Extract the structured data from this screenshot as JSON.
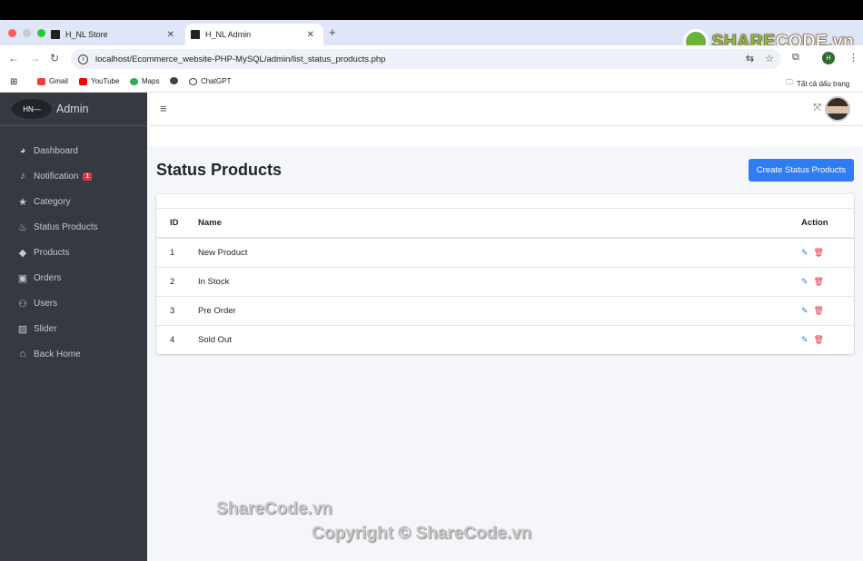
{
  "browser": {
    "tabs": [
      {
        "label": "H_NL Store",
        "active": false
      },
      {
        "label": "H_NL Admin",
        "active": true
      }
    ],
    "url": "localhost/Ecommerce_website-PHP-MySQL/admin/list_status_products.php",
    "profile_initial": "H",
    "bookmarks": [
      {
        "label": "Gmail",
        "color": "#ea4335"
      },
      {
        "label": "YouTube",
        "color": "#ff0000"
      },
      {
        "label": "Maps",
        "color": "#34a853"
      },
      {
        "label": "",
        "color": "#444444"
      },
      {
        "label": "ChatGPT",
        "color": "#444444"
      }
    ],
    "all_bookmarks": "Tất cả dấu trang"
  },
  "watermark_logo": {
    "part1": "SHARE",
    "part2": "CODE.vn"
  },
  "sidebar": {
    "brand_logo": "HN—",
    "brand_text": "Admin",
    "items": [
      {
        "label": "Dashboard",
        "icon": "dashboard-icon",
        "glyph": "◕"
      },
      {
        "label": "Notification",
        "icon": "bell-icon",
        "glyph": "🔔︎",
        "badge": "1"
      },
      {
        "label": "Category",
        "icon": "star-icon",
        "glyph": "★"
      },
      {
        "label": "Status Products",
        "icon": "fire-icon",
        "glyph": "♨"
      },
      {
        "label": "Products",
        "icon": "tag-icon",
        "glyph": "◆"
      },
      {
        "label": "Orders",
        "icon": "shopping-bag-icon",
        "glyph": "▣"
      },
      {
        "label": "Users",
        "icon": "users-icon",
        "glyph": "👥︎"
      },
      {
        "label": "Slider",
        "icon": "image-icon",
        "glyph": "▨"
      },
      {
        "label": "Back Home",
        "icon": "home-icon",
        "glyph": "⌂"
      }
    ]
  },
  "main": {
    "title": "Status Products",
    "create_button": "Create Status Products",
    "table": {
      "headers": {
        "id": "ID",
        "name": "Name",
        "action": "Action"
      },
      "rows": [
        {
          "id": "1",
          "name": "New Product"
        },
        {
          "id": "2",
          "name": "In Stock"
        },
        {
          "id": "3",
          "name": "Pre Order"
        },
        {
          "id": "4",
          "name": "Sold Out"
        }
      ]
    }
  },
  "watermarks": {
    "line1": "ShareCode.vn",
    "line2": "Copyright © ShareCode.vn"
  }
}
